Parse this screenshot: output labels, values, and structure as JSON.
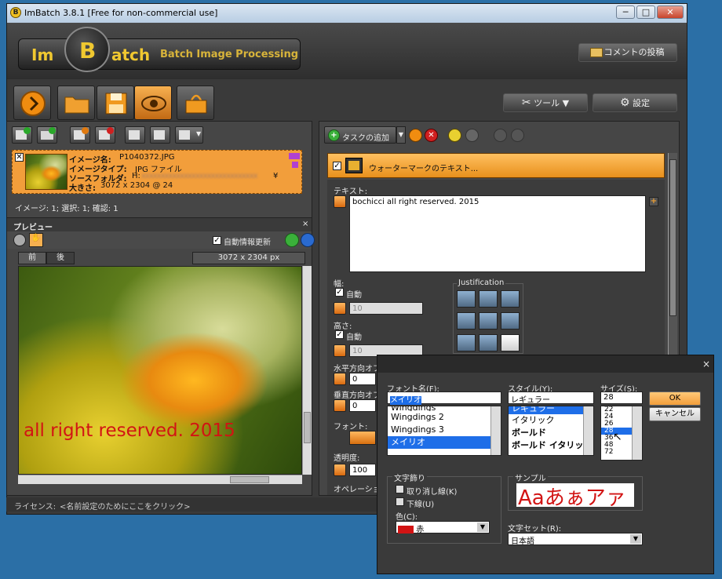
{
  "window": {
    "title": "ImBatch 3.8.1 [Free for non-commercial use]",
    "controls": [
      "─",
      "□",
      "✕"
    ]
  },
  "header": {
    "logo_im": "Im",
    "logo_b": "B",
    "logo_atch": "atch",
    "logo_tagline": "Batch Image Processing",
    "comment_button": "コメントの投稿",
    "tools_button": "ツール",
    "settings_button": "設定"
  },
  "image_item": {
    "name_label": "イメージ名:",
    "name_value": "P1040372.JPG",
    "type_label": "イメージタイプ:",
    "type_value": "JPG ファイル",
    "folder_label": "ソースフォルダ:",
    "folder_value": "H:",
    "folder_mask": "xxxxxxxxxxxxxxxxxxxxxxxxxxxxxx",
    "folder_suffix": "¥",
    "size_label": "大きさ:",
    "size_value": "3072 x 2304 @ 24"
  },
  "counts": "イメージ: 1; 選択: 1; 確認: 1",
  "preview": {
    "title": "プレビュー",
    "close": "×",
    "auto_update": "自動情報更新",
    "tab_before": "前",
    "tab_after": "後",
    "dims": "3072 x 2304 px",
    "watermark_text": "all right reserved. 2015"
  },
  "task_toolbar": {
    "add_task": "タスクの追加"
  },
  "task": {
    "title": "ウォーターマークのテキスト...",
    "text_label": "テキスト:",
    "text_value": "bochicci all right reserved. 2015",
    "width_label": "幅:",
    "auto_label": "自動",
    "width_value": "10",
    "height_label": "高さ:",
    "height_auto_label": "自動",
    "height_value": "10",
    "hoffset_label": "水平方向オフ",
    "hoffset_value": "0",
    "voffset_label": "垂直方向オフ",
    "voffset_value": "0",
    "font_label": "フォント:",
    "opacity_label": "透明度:",
    "opacity_value": "100",
    "operation_label": "オペレーション",
    "justification_label": "Justification"
  },
  "status": {
    "license_label": "ライセンス:",
    "license_value": "<名前設定のためにここをクリック>"
  },
  "font_dialog": {
    "close": "×",
    "font_name_label": "フォント名(F):",
    "font_name_value": "メイリオ",
    "font_list": [
      "Wingdings",
      "Wingdings 2",
      "Wingdings 3",
      "メイリオ"
    ],
    "style_label": "スタイル(Y):",
    "style_value": "レギュラー",
    "style_list": [
      "レギュラー",
      "イタリック",
      "ボールド",
      "ボールド イタリック"
    ],
    "size_label": "サイズ(S):",
    "size_value": "28",
    "size_list": [
      "22",
      "24",
      "26",
      "28",
      "36",
      "48",
      "72"
    ],
    "ok": "OK",
    "cancel": "キャンセル",
    "effects_label": "文字飾り",
    "strike_label": "取り消し線(K)",
    "underline_label": "下線(U)",
    "color_label": "色(C):",
    "color_value": "赤",
    "sample_label": "サンプル",
    "sample_text": "Aaあぁアァ",
    "charset_label": "文字セット(R):",
    "charset_value": "日本語"
  },
  "colors": {
    "accent": "#f29e3b",
    "watermark": "#d21414",
    "selection": "#1e6ee8"
  }
}
